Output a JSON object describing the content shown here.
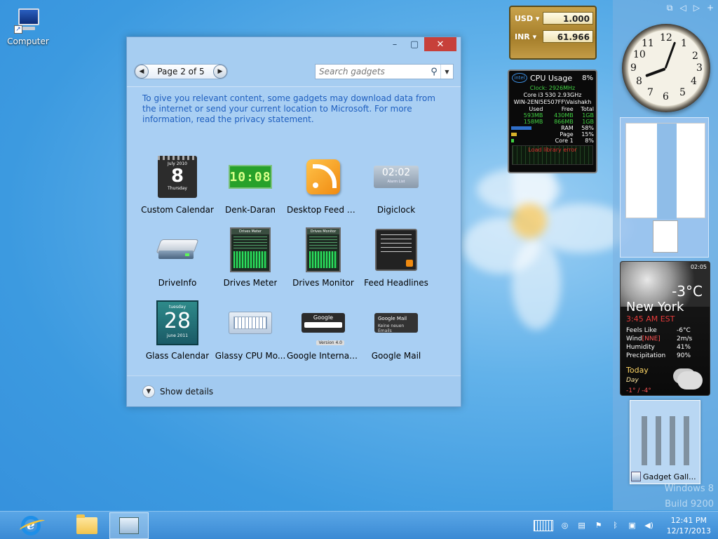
{
  "desktop": {
    "computer_icon_label": "Computer"
  },
  "gallery": {
    "page_label": "Page 2 of 5",
    "search_placeholder": "Search gadgets",
    "notice": "To give you relevant content, some gadgets may download data from the internet or send your current location to Microsoft. For more information, read the privacy statement.",
    "gadgets": [
      {
        "label": "Custom Calendar",
        "icon": "calendar-icon"
      },
      {
        "label": "Denk-Daran",
        "icon": "led-clock-icon"
      },
      {
        "label": "Desktop Feed R...",
        "icon": "rss-icon"
      },
      {
        "label": "Digiclock",
        "icon": "digital-clock-icon"
      },
      {
        "label": "DriveInfo",
        "icon": "drive-icon"
      },
      {
        "label": "Drives Meter",
        "icon": "drives-meter-icon"
      },
      {
        "label": "Drives Monitor",
        "icon": "drives-monitor-icon"
      },
      {
        "label": "Feed Headlines",
        "icon": "feed-headlines-icon"
      },
      {
        "label": "Glass Calendar",
        "icon": "glass-calendar-icon"
      },
      {
        "label": "Glassy CPU Mo...",
        "icon": "cpu-graph-icon"
      },
      {
        "label": "Google Internati...",
        "icon": "google-search-icon"
      },
      {
        "label": "Google Mail",
        "icon": "google-mail-icon"
      }
    ],
    "icon_text": {
      "custom_calendar_month": "July 2010",
      "custom_calendar_day": "8",
      "custom_calendar_weekday": "Thursday",
      "denk_time": "10:08",
      "digiclock_time": "02:02",
      "digiclock_sub": "Alarm List",
      "drives_meter_title": "Drives Meter",
      "drives_monitor_title": "Drives Monitor",
      "glass_calendar_weekday": "tuesday",
      "glass_calendar_day": "28",
      "glass_calendar_month": "june 2011",
      "google_search_brand": "Google",
      "google_version": "Version 4.0",
      "google_mail_title": "Google Mail",
      "google_mail_sub": "Keine neuen Emails"
    },
    "show_details_label": "Show details"
  },
  "currency": {
    "rows": [
      {
        "code": "USD",
        "value": "1.000"
      },
      {
        "code": "INR",
        "value": "61.966"
      }
    ]
  },
  "cpu_gadget": {
    "title": "CPU Usage",
    "percent": "8%",
    "brand": "intel",
    "clock": "Clock: 2926MHz",
    "model": "Core i3 530 2.93GHz",
    "host": "WIN-2ENI5E507FF\\Vaishakh",
    "headers": [
      "Used",
      "Free",
      "Total"
    ],
    "mem_rows": [
      [
        "593MB",
        "430MB",
        "1GB"
      ],
      [
        "158MB",
        "866MB",
        "1GB"
      ]
    ],
    "usage_rows": [
      {
        "label": "RAM",
        "value": "58%",
        "level": 0.58
      },
      {
        "label": "Page",
        "value": "15%",
        "level": 0.15
      },
      {
        "label": "Core 1",
        "value": "8%",
        "level": 0.08
      }
    ],
    "error": "Load library error"
  },
  "clock_gadget": {
    "numbers": [
      "12",
      "1",
      "2",
      "3",
      "4",
      "5",
      "6",
      "7",
      "8",
      "9",
      "10",
      "11"
    ]
  },
  "weather": {
    "time": "02:05",
    "temperature": "-3°C",
    "city": "New York",
    "local_time": "3:45 AM EST",
    "details": [
      {
        "label": "Feels Like",
        "value": "-6°C"
      },
      {
        "label": "Wind",
        "value": "2m/s",
        "extra": "[NNE]"
      },
      {
        "label": "Humidity",
        "value": "41%"
      },
      {
        "label": "Precipitation",
        "value": "90%"
      }
    ],
    "today_label": "Today",
    "day_label": "Day",
    "range": "-1° / -4°"
  },
  "gadget_gallery_thumb": {
    "label": "Gadget Gall..."
  },
  "watermark": {
    "line1": "Windows 8",
    "line2": "Build 9200"
  },
  "taskbar": {
    "time": "12:41 PM",
    "date": "12/17/2013"
  }
}
